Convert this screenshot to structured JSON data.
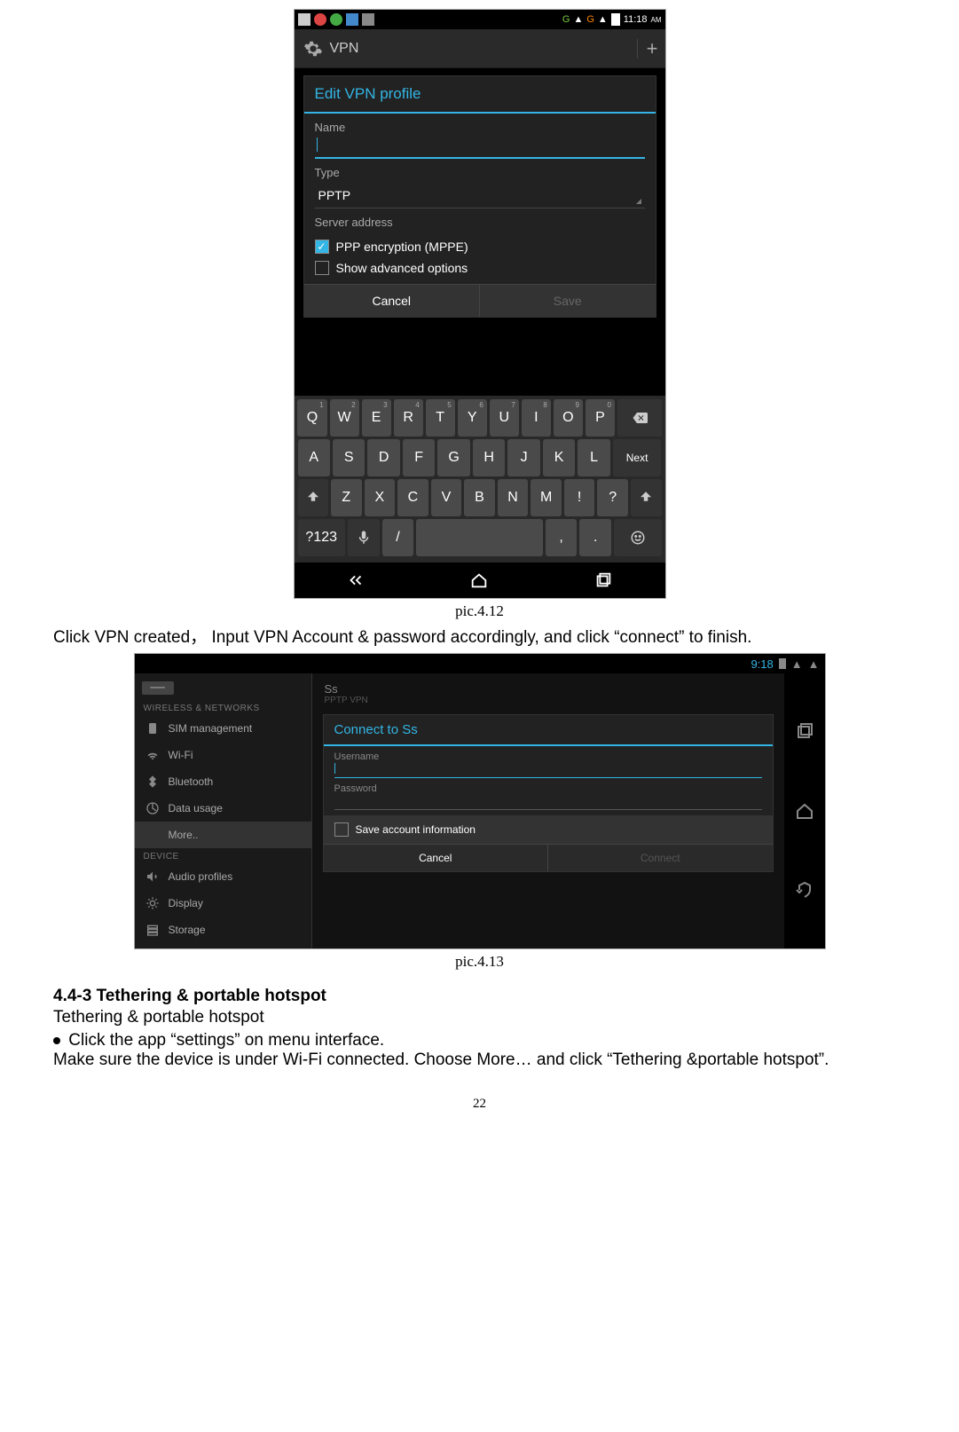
{
  "shot1": {
    "status_time": "11:18",
    "status_ampm": "AM",
    "status_g1": "G",
    "status_g2": "G",
    "header_title": "VPN",
    "dialog_title": "Edit VPN profile",
    "name_label": "Name",
    "type_label": "Type",
    "type_value": "PPTP",
    "server_label": "Server address",
    "ppp_label": "PPP encryption (MPPE)",
    "adv_label": "Show advanced options",
    "cancel": "Cancel",
    "save": "Save",
    "kb_row1": [
      "Q",
      "W",
      "E",
      "R",
      "T",
      "Y",
      "U",
      "I",
      "O",
      "P"
    ],
    "kb_row1_hints": [
      "1",
      "2",
      "3",
      "4",
      "5",
      "6",
      "7",
      "8",
      "9",
      "0"
    ],
    "kb_row2": [
      "A",
      "S",
      "D",
      "F",
      "G",
      "H",
      "J",
      "K",
      "L"
    ],
    "kb_next": "Next",
    "kb_row3": [
      "Z",
      "X",
      "C",
      "V",
      "B",
      "N",
      "M",
      "!",
      "?"
    ],
    "kb_sym": "?123",
    "kb_slash": "/",
    "kb_comma": ",",
    "kb_period": "."
  },
  "caption1": "pic.4.12",
  "paragraph1": "Click VPN created，  Input VPN Account & password accordingly, and click “connect” to finish.",
  "shot2": {
    "status_time": "9:18",
    "cat_wireless": "WIRELESS & NETWORKS",
    "cat_device": "DEVICE",
    "sidebar": [
      {
        "label": "SIM management"
      },
      {
        "label": "Wi-Fi"
      },
      {
        "label": "Bluetooth"
      },
      {
        "label": "Data usage"
      },
      {
        "label": "More..",
        "active": true
      }
    ],
    "sidebar2": [
      {
        "label": "Audio profiles"
      },
      {
        "label": "Display"
      },
      {
        "label": "Storage"
      }
    ],
    "faded_title": "Ss",
    "faded_sub": "PPTP VPN",
    "dialog_title": "Connect to Ss",
    "username_label": "Username",
    "password_label": "Password",
    "save_account": "Save account information",
    "cancel": "Cancel",
    "connect": "Connect"
  },
  "caption2": "pic.4.13",
  "section_heading": "4.4-3 Tethering & portable hotspot",
  "section_sub": "Tethering & portable hotspot",
  "bullet1": "Click the app “settings” on menu interface.",
  "para2": " Make sure the device is under Wi-Fi connected. Choose More… and click “Tethering &portable hotspot”.",
  "page_number": "22"
}
